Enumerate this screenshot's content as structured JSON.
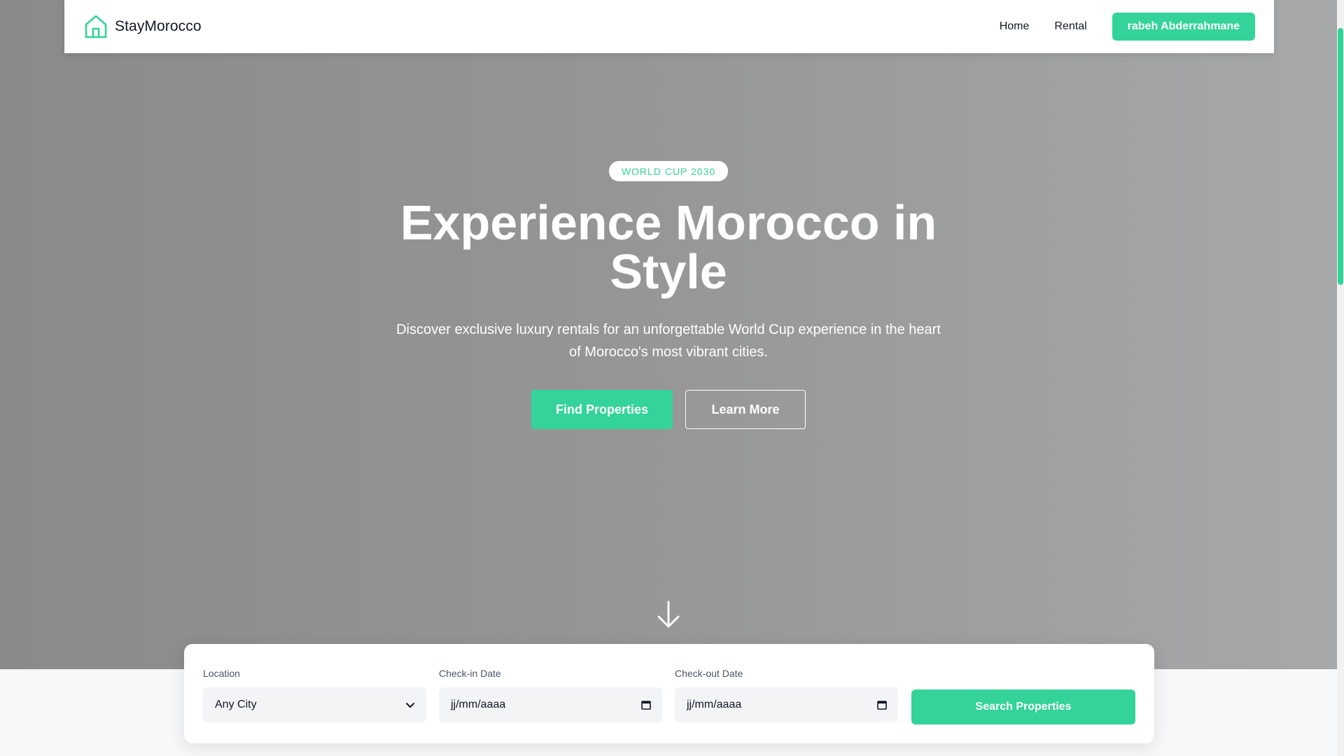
{
  "brand": {
    "name": "StayMorocco",
    "icon": "home-icon"
  },
  "nav": {
    "links": [
      {
        "label": "Home"
      },
      {
        "label": "Rental"
      }
    ],
    "user_button": "rabeh Abderrahmane"
  },
  "hero": {
    "badge": "WORLD CUP 2030",
    "title": "Experience Morocco in Style",
    "subtitle": "Discover exclusive luxury rentals for an unforgettable World Cup experience in the heart of Morocco's most vibrant cities.",
    "primary_button": "Find Properties",
    "secondary_button": "Learn More",
    "scroll_icon": "arrow-down-icon"
  },
  "search": {
    "location": {
      "label": "Location",
      "value": "Any City",
      "icon": "chevron-down-icon"
    },
    "check_in": {
      "label": "Check-in Date",
      "value": "jj/mm/aaaa",
      "icon": "calendar-icon"
    },
    "check_out": {
      "label": "Check-out Date",
      "value": "jj/mm/aaaa",
      "icon": "calendar-icon"
    },
    "button": "Search Properties"
  },
  "colors": {
    "accent": "#34d399",
    "text_dark": "#111827",
    "hero_overlay_left": "#8a8a8a",
    "hero_overlay_right": "#a6a8a9"
  }
}
